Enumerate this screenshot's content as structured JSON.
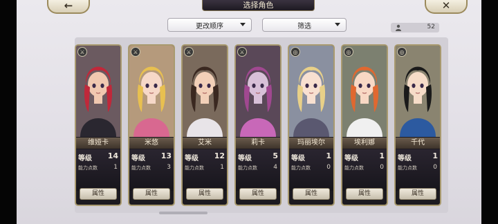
{
  "header": {
    "title": "选择角色",
    "back_icon": "←",
    "close_icon": "✕"
  },
  "toolbar": {
    "sort_label": "更改顺序",
    "filter_label": "筛选",
    "count": "52"
  },
  "labels": {
    "level": "等级",
    "ability_points": "能力点数",
    "attribute_button": "属性"
  },
  "characters": [
    {
      "name": "维娅卡",
      "level": "14",
      "points": "1",
      "class_icon": "⚔",
      "hair": "#c0283a",
      "skin": "#f0c8b0",
      "bg": "#6b5a60",
      "outfit": "#2a2730"
    },
    {
      "name": "米悠",
      "level": "13",
      "points": "3",
      "class_icon": "⚔",
      "hair": "#e8c050",
      "skin": "#f6d8c8",
      "bg": "#b59a7c",
      "outfit": "#d86890"
    },
    {
      "name": "艾米",
      "level": "12",
      "points": "1",
      "class_icon": "⚔",
      "hair": "#3a2820",
      "skin": "#f2d0b8",
      "bg": "#7a6a5c",
      "outfit": "#e8e4e8"
    },
    {
      "name": "莉卡",
      "level": "5",
      "points": "4",
      "class_icon": "⚔",
      "hair": "#a04890",
      "skin": "#d8c0d8",
      "bg": "#5a4858",
      "outfit": "#c868b8"
    },
    {
      "name": "玛丽埃尔",
      "level": "1",
      "points": "0",
      "class_icon": "◎",
      "hair": "#e8d088",
      "skin": "#f8e0d0",
      "bg": "#8a90a0",
      "outfit": "#5a5870"
    },
    {
      "name": "埃利娜",
      "level": "1",
      "points": "0",
      "class_icon": "◎",
      "hair": "#e06830",
      "skin": "#f8d8c4",
      "bg": "#7c8070",
      "outfit": "#f0f0f0"
    },
    {
      "name": "千代",
      "level": "1",
      "points": "0",
      "class_icon": "◎",
      "hair": "#1a1a1a",
      "skin": "#f6dcc8",
      "bg": "#8a8470",
      "outfit": "#2c5aa0"
    }
  ]
}
